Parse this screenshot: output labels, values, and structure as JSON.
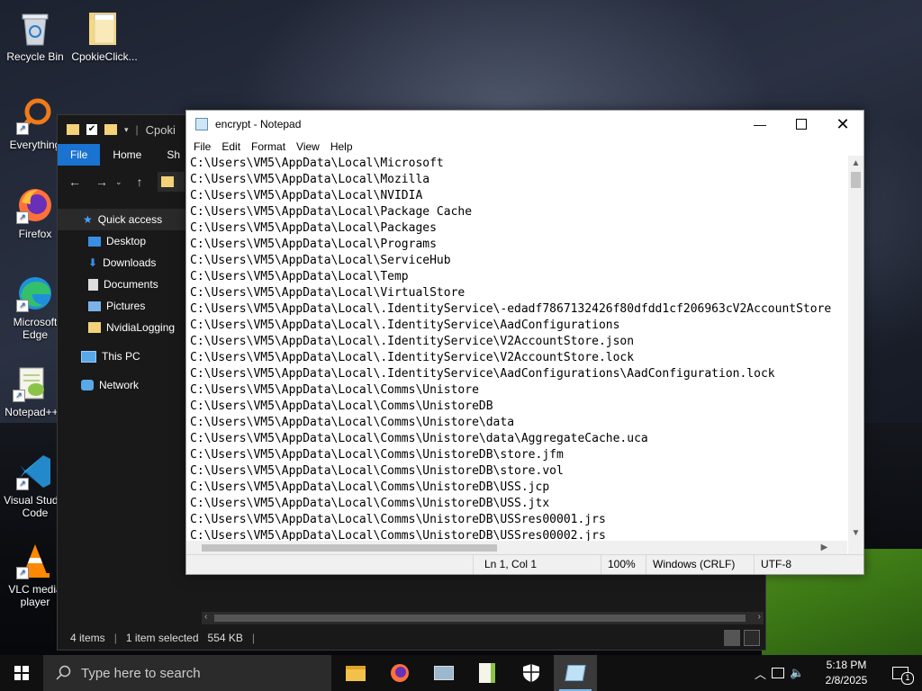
{
  "desktop": {
    "icons": [
      {
        "label": "Recycle Bin"
      },
      {
        "label": "CpokieClick..."
      },
      {
        "label": "Everything"
      },
      {
        "label": "Firefox"
      },
      {
        "label": "Microsoft Edge"
      },
      {
        "label": "Notepad++"
      },
      {
        "label": "Visual Studio Code"
      },
      {
        "label": "VLC media player"
      }
    ]
  },
  "explorer": {
    "title_fragment": "Cpoki",
    "ribbon": {
      "file": "File",
      "home": "Home",
      "share": "Sh"
    },
    "sidebar": [
      {
        "label": "Quick access"
      },
      {
        "label": "Desktop"
      },
      {
        "label": "Downloads"
      },
      {
        "label": "Documents"
      },
      {
        "label": "Pictures"
      },
      {
        "label": "NvidiaLogging"
      },
      {
        "label": "This PC"
      },
      {
        "label": "Network"
      }
    ],
    "status": {
      "items": "4 items",
      "selected": "1 item selected",
      "size": "554 KB"
    }
  },
  "notepad": {
    "title": "encrypt - Notepad",
    "menu": [
      "File",
      "Edit",
      "Format",
      "View",
      "Help"
    ],
    "lines": [
      "C:\\Users\\VM5\\AppData\\Local\\Microsoft",
      "C:\\Users\\VM5\\AppData\\Local\\Mozilla",
      "C:\\Users\\VM5\\AppData\\Local\\NVIDIA",
      "C:\\Users\\VM5\\AppData\\Local\\Package Cache",
      "C:\\Users\\VM5\\AppData\\Local\\Packages",
      "C:\\Users\\VM5\\AppData\\Local\\Programs",
      "C:\\Users\\VM5\\AppData\\Local\\ServiceHub",
      "C:\\Users\\VM5\\AppData\\Local\\Temp",
      "C:\\Users\\VM5\\AppData\\Local\\VirtualStore",
      "C:\\Users\\VM5\\AppData\\Local\\.IdentityService\\-edadf7867132426f80dfdd1cf206963cV2AccountStore",
      "C:\\Users\\VM5\\AppData\\Local\\.IdentityService\\AadConfigurations",
      "C:\\Users\\VM5\\AppData\\Local\\.IdentityService\\V2AccountStore.json",
      "C:\\Users\\VM5\\AppData\\Local\\.IdentityService\\V2AccountStore.lock",
      "C:\\Users\\VM5\\AppData\\Local\\.IdentityService\\AadConfigurations\\AadConfiguration.lock",
      "C:\\Users\\VM5\\AppData\\Local\\Comms\\Unistore",
      "C:\\Users\\VM5\\AppData\\Local\\Comms\\UnistoreDB",
      "C:\\Users\\VM5\\AppData\\Local\\Comms\\Unistore\\data",
      "C:\\Users\\VM5\\AppData\\Local\\Comms\\Unistore\\data\\AggregateCache.uca",
      "C:\\Users\\VM5\\AppData\\Local\\Comms\\UnistoreDB\\store.jfm",
      "C:\\Users\\VM5\\AppData\\Local\\Comms\\UnistoreDB\\store.vol",
      "C:\\Users\\VM5\\AppData\\Local\\Comms\\UnistoreDB\\USS.jcp",
      "C:\\Users\\VM5\\AppData\\Local\\Comms\\UnistoreDB\\USS.jtx",
      "C:\\Users\\VM5\\AppData\\Local\\Comms\\UnistoreDB\\USSres00001.jrs",
      "C:\\Users\\VM5\\AppData\\Local\\Comms\\UnistoreDB\\USSres00002.jrs"
    ],
    "status": {
      "position": "Ln 1, Col 1",
      "zoom": "100%",
      "line_ending": "Windows (CRLF)",
      "encoding": "UTF-8"
    }
  },
  "taskbar": {
    "search_placeholder": "Type here to search",
    "time": "5:18 PM",
    "date": "2/8/2025",
    "notification_count": "1"
  },
  "colors": {
    "accent": "#1a73d0",
    "taskbar": "#101010"
  }
}
